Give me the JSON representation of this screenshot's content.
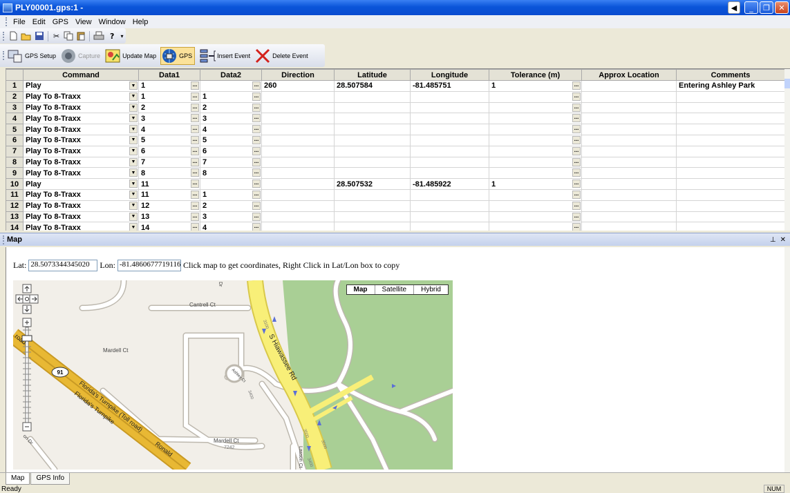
{
  "window": {
    "title": "PLY00001.gps:1 -"
  },
  "menu": [
    "File",
    "Edit",
    "GPS",
    "View",
    "Window",
    "Help"
  ],
  "toolbar2": {
    "gps_setup": "GPS Setup",
    "capture": "Capture",
    "update_map": "Update Map",
    "gps": "GPS",
    "insert_event": "Insert Event",
    "delete_event": "Delete Event"
  },
  "grid": {
    "columns": [
      "Command",
      "Data1",
      "Data2",
      "Direction",
      "Latitude",
      "Longitude",
      "Tolerance (m)",
      "Approx Location",
      "Comments"
    ],
    "rows": [
      {
        "n": "1",
        "command": "Play",
        "data1": "1",
        "data2": "",
        "direction": "260",
        "latitude": "28.507584",
        "longitude": "-81.485751",
        "tolerance": "1",
        "approx": "",
        "comments": "Entering Ashley Park"
      },
      {
        "n": "2",
        "command": "Play To 8-Traxx",
        "data1": "1",
        "data2": "1",
        "direction": "",
        "latitude": "",
        "longitude": "",
        "tolerance": "",
        "approx": "",
        "comments": ""
      },
      {
        "n": "3",
        "command": "Play To 8-Traxx",
        "data1": "2",
        "data2": "2",
        "direction": "",
        "latitude": "",
        "longitude": "",
        "tolerance": "",
        "approx": "",
        "comments": ""
      },
      {
        "n": "4",
        "command": "Play To 8-Traxx",
        "data1": "3",
        "data2": "3",
        "direction": "",
        "latitude": "",
        "longitude": "",
        "tolerance": "",
        "approx": "",
        "comments": ""
      },
      {
        "n": "5",
        "command": "Play To 8-Traxx",
        "data1": "4",
        "data2": "4",
        "direction": "",
        "latitude": "",
        "longitude": "",
        "tolerance": "",
        "approx": "",
        "comments": ""
      },
      {
        "n": "6",
        "command": "Play To 8-Traxx",
        "data1": "5",
        "data2": "5",
        "direction": "",
        "latitude": "",
        "longitude": "",
        "tolerance": "",
        "approx": "",
        "comments": ""
      },
      {
        "n": "7",
        "command": "Play To 8-Traxx",
        "data1": "6",
        "data2": "6",
        "direction": "",
        "latitude": "",
        "longitude": "",
        "tolerance": "",
        "approx": "",
        "comments": ""
      },
      {
        "n": "8",
        "command": "Play To 8-Traxx",
        "data1": "7",
        "data2": "7",
        "direction": "",
        "latitude": "",
        "longitude": "",
        "tolerance": "",
        "approx": "",
        "comments": ""
      },
      {
        "n": "9",
        "command": "Play To 8-Traxx",
        "data1": "8",
        "data2": "8",
        "direction": "",
        "latitude": "",
        "longitude": "",
        "tolerance": "",
        "approx": "",
        "comments": ""
      },
      {
        "n": "10",
        "command": "Play",
        "data1": "11",
        "data2": "",
        "direction": "",
        "latitude": "28.507532",
        "longitude": "-81.485922",
        "tolerance": "1",
        "approx": "",
        "comments": ""
      },
      {
        "n": "11",
        "command": "Play To 8-Traxx",
        "data1": "11",
        "data2": "1",
        "direction": "",
        "latitude": "",
        "longitude": "",
        "tolerance": "",
        "approx": "",
        "comments": ""
      },
      {
        "n": "12",
        "command": "Play To 8-Traxx",
        "data1": "12",
        "data2": "2",
        "direction": "",
        "latitude": "",
        "longitude": "",
        "tolerance": "",
        "approx": "",
        "comments": ""
      },
      {
        "n": "13",
        "command": "Play To 8-Traxx",
        "data1": "13",
        "data2": "3",
        "direction": "",
        "latitude": "",
        "longitude": "",
        "tolerance": "",
        "approx": "",
        "comments": ""
      },
      {
        "n": "14",
        "command": "Play To 8-Traxx",
        "data1": "14",
        "data2": "4",
        "direction": "",
        "latitude": "",
        "longitude": "",
        "tolerance": "",
        "approx": "",
        "comments": ""
      }
    ]
  },
  "map_pane": {
    "title": "Map",
    "lat_label": "Lat:",
    "lat_value": "28.5073344345020",
    "lon_label": "Lon:",
    "lon_value": "-81.4860677719116",
    "hint": "Click map to get coordinates, Right Click in Lat/Lon box to copy",
    "map_types": [
      "Map",
      "Satellite",
      "Hybrid"
    ],
    "labels": {
      "cantrell": "Cantrell Ct",
      "mardell1": "Mardell Ct",
      "mardell2": "Mardell Ct",
      "num7242": "7242",
      "hiawassee": "S Hiawassee Rd",
      "turnpike1": "Florida's Turnpike (Toll road)",
      "turnpike2": "Florida's Turnpike",
      "ronald": "Ronald",
      "road": "road",
      "shield91": "91",
      "lasson": "Lasson Ct",
      "ashley": "Ashley Ct",
      "n3100": "3100",
      "n3400": "3400",
      "n3500a": "3500",
      "n3500b": "3500",
      "n3400b": "3400",
      "dr": "Dr",
      "ondr": "on Dr"
    }
  },
  "tabs": [
    "Map",
    "GPS Info"
  ],
  "status": {
    "left": "Ready",
    "num": "NUM"
  }
}
